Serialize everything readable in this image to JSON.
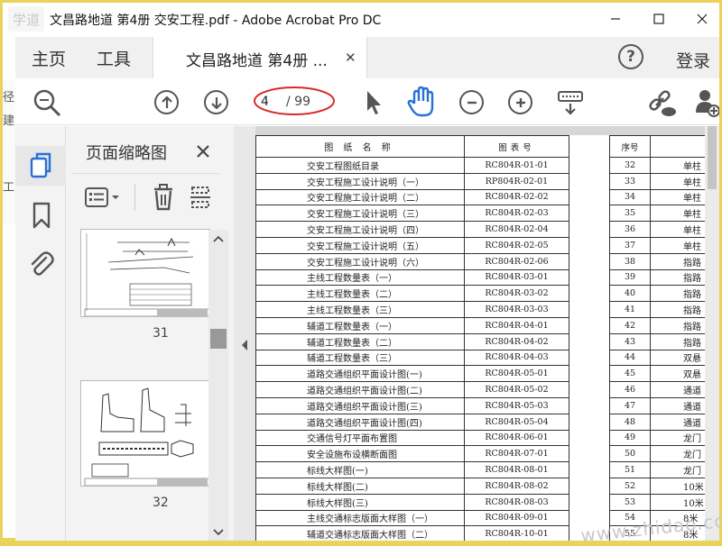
{
  "window": {
    "title": "文昌路地道 第4册 交安工程.pdf - Adobe Acrobat Pro DC",
    "logo_text": "学道"
  },
  "menubar": {
    "home": "主页",
    "tools": "工具",
    "doc_tab": "文昌路地道 第4册 ...",
    "login": "登录"
  },
  "toolbar": {
    "current_page": "4",
    "total_pages": "/ 99"
  },
  "left_clip": [
    "径",
    "建",
    "工"
  ],
  "thumb_panel": {
    "title": "页面缩略图",
    "pages": [
      "31",
      "32"
    ]
  },
  "table": {
    "header": {
      "name": "图 纸 名 称",
      "code": "图表号"
    },
    "rows": [
      {
        "name": "交安工程图纸目录",
        "code": "RC804R-01-01"
      },
      {
        "name": "交安工程施工设计说明（一）",
        "code": "RP804R-02-01"
      },
      {
        "name": "交安工程施工设计说明（二）",
        "code": "RC804R-02-02"
      },
      {
        "name": "交安工程施工设计说明（三）",
        "code": "RC804R-02-03"
      },
      {
        "name": "交安工程施工设计说明（四）",
        "code": "RC804R-02-04"
      },
      {
        "name": "交安工程施工设计说明（五）",
        "code": "RC804R-02-05"
      },
      {
        "name": "交安工程施工设计说明（六）",
        "code": "RC804R-02-06"
      },
      {
        "name": "主线工程数量表（一）",
        "code": "RC804R-03-01"
      },
      {
        "name": "主线工程数量表（二）",
        "code": "RC804R-03-02"
      },
      {
        "name": "主线工程数量表（三）",
        "code": "RC804R-03-03"
      },
      {
        "name": "辅道工程数量表（一）",
        "code": "RC804R-04-01"
      },
      {
        "name": "辅道工程数量表（二）",
        "code": "RC804R-04-02"
      },
      {
        "name": "辅道工程数量表（三）",
        "code": "RC804R-04-03"
      },
      {
        "name": "道路交通组织平面设计图(一)",
        "code": "RC804R-05-01"
      },
      {
        "name": "道路交通组织平面设计图(二)",
        "code": "RC804R-05-02"
      },
      {
        "name": "道路交通组织平面设计图(三)",
        "code": "RC804R-05-03"
      },
      {
        "name": "道路交通组织平面设计图(四)",
        "code": "RC804R-05-04"
      },
      {
        "name": "交通信号灯平面布置图",
        "code": "RC804R-06-01"
      },
      {
        "name": "安全设施布设横断面图",
        "code": "RC804R-07-01"
      },
      {
        "name": "标线大样图(一)",
        "code": "RC804R-08-01"
      },
      {
        "name": "标线大样图(二)",
        "code": "RC804R-08-02"
      },
      {
        "name": "标线大样图(三)",
        "code": "RC804R-08-03"
      },
      {
        "name": "主线交通标志版面大样图（一）",
        "code": "RC804R-09-01"
      },
      {
        "name": "辅道交通标志版面大样图（二）",
        "code": "RC804R-10-01"
      }
    ]
  },
  "side_table": {
    "header": "序号",
    "rows": [
      {
        "no": "32",
        "text": "单柱"
      },
      {
        "no": "33",
        "text": "单柱"
      },
      {
        "no": "34",
        "text": "单柱"
      },
      {
        "no": "35",
        "text": "单柱"
      },
      {
        "no": "36",
        "text": "单柱"
      },
      {
        "no": "37",
        "text": "单柱"
      },
      {
        "no": "38",
        "text": "指路"
      },
      {
        "no": "39",
        "text": "指路"
      },
      {
        "no": "40",
        "text": "指路"
      },
      {
        "no": "41",
        "text": "指路"
      },
      {
        "no": "42",
        "text": "指路"
      },
      {
        "no": "43",
        "text": "指路"
      },
      {
        "no": "44",
        "text": "双悬"
      },
      {
        "no": "45",
        "text": "双悬"
      },
      {
        "no": "46",
        "text": "通道"
      },
      {
        "no": "47",
        "text": "通道"
      },
      {
        "no": "48",
        "text": "通道"
      },
      {
        "no": "49",
        "text": "龙门"
      },
      {
        "no": "50",
        "text": "龙门"
      },
      {
        "no": "51",
        "text": "龙门"
      },
      {
        "no": "52",
        "text": "10米"
      },
      {
        "no": "53",
        "text": "10米"
      },
      {
        "no": "54",
        "text": "8米"
      },
      {
        "no": "55",
        "text": "8米"
      }
    ]
  },
  "watermark": "www.zhidao.com",
  "colors": {
    "annotation_red": "#d62a2a",
    "hand_tool_blue": "#2a6fd6",
    "panel_bg": "#f3f3f3"
  }
}
